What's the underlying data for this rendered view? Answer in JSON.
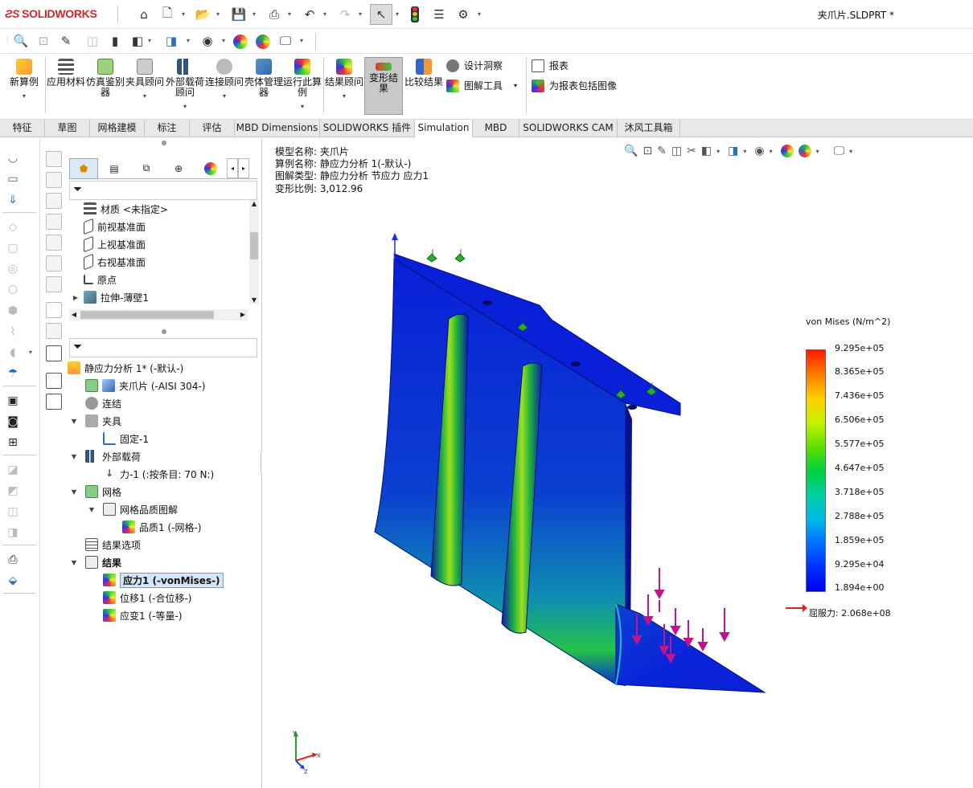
{
  "app": {
    "logo": "SOLIDWORKS",
    "document_title": "夹爪片.SLDPRT *"
  },
  "ribbon": {
    "buttons": [
      "新算例",
      "应用材料",
      "仿真鉴别器",
      "夹具顾问",
      "外部载荷顾问",
      "连接顾问",
      "壳体管理器",
      "运行此算例",
      "结果顾问",
      "变形结果",
      "比较结果"
    ],
    "small": {
      "design_insight": "设计洞察",
      "plot_tools": "图解工具",
      "report": "报表",
      "include_image": "为报表包括图像"
    }
  },
  "tabs": [
    "特征",
    "草图",
    "网格建模",
    "标注",
    "评估",
    "MBD Dimensions",
    "SOLIDWORKS 插件",
    "Simulation",
    "MBD",
    "SOLIDWORKS CAM",
    "沐风工具箱"
  ],
  "active_tab": "Simulation",
  "feature_tree": [
    "材质 <未指定>",
    "前视基准面",
    "上视基准面",
    "右视基准面",
    "原点",
    "拉伸-薄壁1"
  ],
  "study_tree": {
    "study": "静应力分析 1* (-默认-)",
    "part": "夹爪片 (-AISI 304-)",
    "connections": "连结",
    "fixtures": "夹具",
    "fixed": "固定-1",
    "loads": "外部载荷",
    "force": "力-1 (:按条目: 70 N:)",
    "mesh": "网格",
    "mesh_quality": "网格品质图解",
    "quality": "品质1 (-网格-)",
    "result_options": "结果选项",
    "results": "结果",
    "stress": "应力1 (-vonMises-)",
    "displacement": "位移1 (-合位移-)",
    "strain": "应变1 (-等量-)"
  },
  "plot_info": {
    "model_name": "模型名称: 夹爪片",
    "study_name": "算例名称: 静应力分析 1(-默认-)",
    "plot_type": "图解类型: 静应力分析 节应力 应力1",
    "deformation_scale": "变形比例: 3,012.96"
  },
  "legend": {
    "title": "von Mises (N/m^2)",
    "values": [
      "9.295e+05",
      "8.365e+05",
      "7.436e+05",
      "6.506e+05",
      "5.577e+05",
      "4.647e+05",
      "3.718e+05",
      "2.788e+05",
      "1.859e+05",
      "9.295e+04",
      "1.894e+00"
    ],
    "yield": "屈服力: 2.068e+08"
  },
  "triad": {
    "x": "X",
    "y": "Y",
    "z": "Z"
  },
  "colors": {
    "accent_red": "#d0262d",
    "model_blue": "#0a1fd8",
    "load_magenta": "#c0148c",
    "fixture_green": "#2faa2f"
  }
}
